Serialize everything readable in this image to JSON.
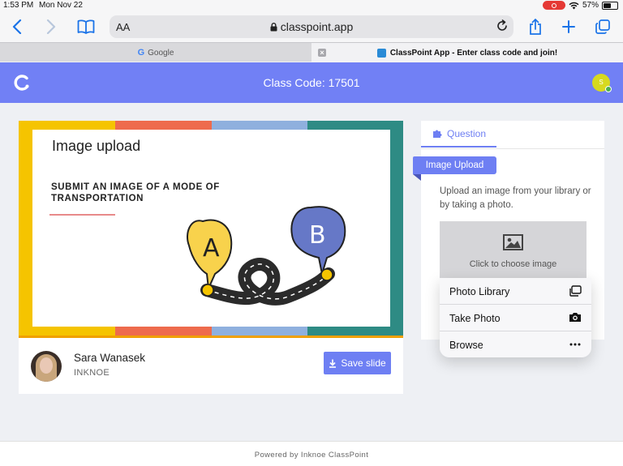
{
  "status_bar": {
    "time": "1:53 PM",
    "date": "Mon Nov 22",
    "battery": "57%"
  },
  "browser": {
    "text_size_label": "AA",
    "url": "classpoint.app",
    "tabs": [
      {
        "label": "Google",
        "active": false
      },
      {
        "label": "ClassPoint App - Enter class code and join!",
        "active": true
      }
    ]
  },
  "header": {
    "class_code": "Class Code: 17501",
    "avatar_initial": "S",
    "brand_color": "#7180f5"
  },
  "slide": {
    "title": "Image upload",
    "subtitle": "SUBMIT AN IMAGE OF A MODE OF TRANSPORTATION",
    "label_a": "A",
    "label_b": "B",
    "band_colors": [
      "#f5c400",
      "#ee6b4d",
      "#8fb0de",
      "#2e8b84"
    ]
  },
  "presenter": {
    "name": "Sara Wanasek",
    "organization": "INKNOE"
  },
  "actions": {
    "save_label": "Save slide"
  },
  "question": {
    "tab_label": "Question",
    "type_label": "Image Upload",
    "description": "Upload an image from your library or by taking a photo.",
    "chooser_label": "Click to choose image",
    "menu_items": [
      {
        "label": "Photo Library",
        "icon": "photo-library-icon"
      },
      {
        "label": "Take Photo",
        "icon": "camera-icon"
      },
      {
        "label": "Browse",
        "icon": "more-icon"
      }
    ]
  },
  "footer": {
    "text": "Powered by Inknoe ClassPoint"
  }
}
